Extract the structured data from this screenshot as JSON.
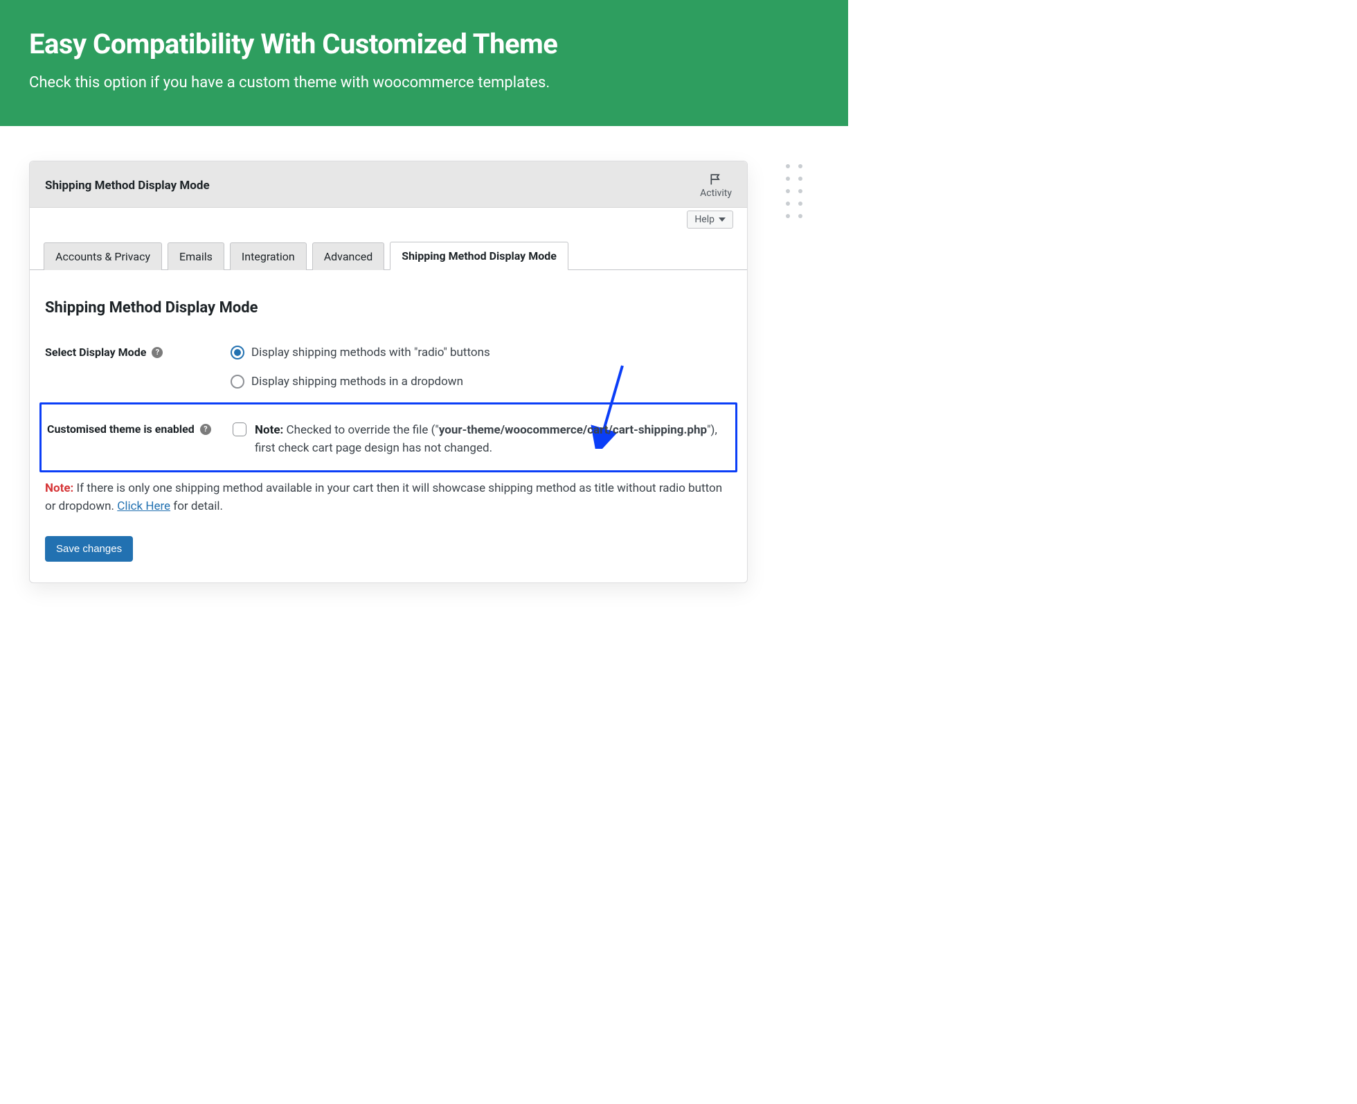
{
  "hero": {
    "title": "Easy Compatibility With Customized Theme",
    "subtitle": "Check this option if you have a custom theme with woocommerce templates."
  },
  "panel": {
    "title": "Shipping Method Display Mode",
    "activity_label": "Activity",
    "help_label": "Help"
  },
  "tabs": [
    {
      "label": "Accounts & Privacy",
      "active": false
    },
    {
      "label": "Emails",
      "active": false
    },
    {
      "label": "Integration",
      "active": false
    },
    {
      "label": "Advanced",
      "active": false
    },
    {
      "label": "Shipping Method Display Mode",
      "active": true
    }
  ],
  "section_heading": "Shipping Method Display Mode",
  "display_mode": {
    "label": "Select Display Mode",
    "options": [
      {
        "label": "Display shipping methods with \"radio\" buttons",
        "checked": true
      },
      {
        "label": "Display shipping methods in a dropdown",
        "checked": false
      }
    ]
  },
  "custom_theme": {
    "label": "Customised theme is enabled",
    "checked": false,
    "note_label": "Note:",
    "note_before": " Checked to override the file (\"",
    "note_path": "your-theme/woocommerce/cart/cart-shipping.php",
    "note_after": "\"), first check cart page design has not changed."
  },
  "bottom_note": {
    "label": "Note:",
    "text_before": " If there is only one shipping method available in your cart then it will showcase shipping method as title without radio button or dropdown. ",
    "link_text": "Click Here",
    "text_after": " for detail."
  },
  "save_button": "Save changes"
}
